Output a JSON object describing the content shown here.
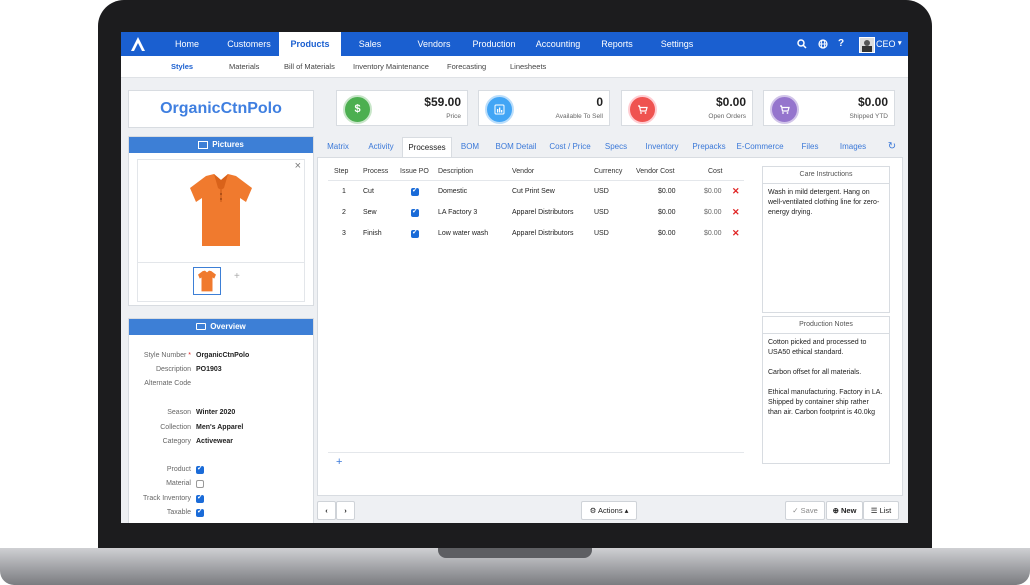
{
  "nav": {
    "items": [
      "Home",
      "Customers",
      "Products",
      "Sales",
      "Vendors",
      "Production",
      "Accounting",
      "Reports",
      "Settings"
    ],
    "active": "Products",
    "user": "CEO",
    "icons": [
      "search-icon",
      "globe-icon",
      "help-icon",
      "avatar",
      "caret-down-icon"
    ]
  },
  "subnav": {
    "items": [
      "Styles",
      "Materials",
      "Bill of Materials",
      "Inventory Maintenance",
      "Forecasting",
      "Linesheets"
    ],
    "active": "Styles"
  },
  "style_name": "OrganicCtnPolo",
  "kpis": [
    {
      "value": "$59.00",
      "label": "Price",
      "color": "#4caf50",
      "icon": "dollar-icon"
    },
    {
      "value": "0",
      "label": "Available To Sell",
      "color": "#42a5f5",
      "icon": "chart-icon"
    },
    {
      "value": "$0.00",
      "label": "Open Orders",
      "color": "#ef5350",
      "icon": "cart-icon"
    },
    {
      "value": "$0.00",
      "label": "Shipped YTD",
      "color": "#9575cd",
      "icon": "cart-icon"
    }
  ],
  "pictures": {
    "title": "Pictures",
    "close": "×",
    "add": "+"
  },
  "overview": {
    "title": "Overview",
    "fields": [
      {
        "label": "Style Number",
        "value": "OrganicCtnPolo",
        "required": true
      },
      {
        "label": "Description",
        "value": "PO1903"
      },
      {
        "label": "Alternate Code",
        "value": ""
      },
      {
        "label": "Season",
        "value": "Winter 2020"
      },
      {
        "label": "Collection",
        "value": "Men's Apparel"
      },
      {
        "label": "Category",
        "value": "Activewear"
      }
    ],
    "checks": [
      {
        "label": "Product",
        "checked": true
      },
      {
        "label": "Material",
        "checked": false
      },
      {
        "label": "Track Inventory",
        "checked": true
      },
      {
        "label": "Taxable",
        "checked": true
      }
    ]
  },
  "tabs": [
    "Matrix",
    "Activity",
    "Processes",
    "BOM",
    "BOM Detail",
    "Cost / Price",
    "Specs",
    "Inventory",
    "Prepacks",
    "E-Commerce",
    "Files",
    "Images"
  ],
  "active_tab": "Processes",
  "table": {
    "headers": [
      "Step",
      "Process",
      "Issue PO",
      "Description",
      "Vendor",
      "Currency",
      "Vendor Cost",
      "Cost"
    ],
    "rows": [
      {
        "step": "1",
        "process": "Cut",
        "issue_po": true,
        "description": "Domestic",
        "vendor": "Cut Print Sew",
        "currency": "USD",
        "vendor_cost": "$0.00",
        "cost": "$0.00"
      },
      {
        "step": "2",
        "process": "Sew",
        "issue_po": true,
        "description": "LA Factory 3",
        "vendor": "Apparel Distributors",
        "currency": "USD",
        "vendor_cost": "$0.00",
        "cost": "$0.00"
      },
      {
        "step": "3",
        "process": "Finish",
        "issue_po": true,
        "description": "Low water wash",
        "vendor": "Apparel Distributors",
        "currency": "USD",
        "vendor_cost": "$0.00",
        "cost": "$0.00"
      }
    ],
    "add": "+"
  },
  "care": {
    "title": "Care Instructions",
    "text": "Wash in mild detergent. Hang on well-ventilated clothing line for zero-energy drying."
  },
  "notes": {
    "title": "Production Notes",
    "text": "Cotton picked and processed to USA50 ethical standard.\n\nCarbon offset for all materials.\n\nEthical manufacturing. Factory in LA.\nShipped by container ship rather than air. Carbon footprint is 40.0kg"
  },
  "bottom": {
    "prev": "‹",
    "next": "›",
    "actions": "Actions ▴",
    "save": "Save",
    "new": "New",
    "list": "List"
  }
}
